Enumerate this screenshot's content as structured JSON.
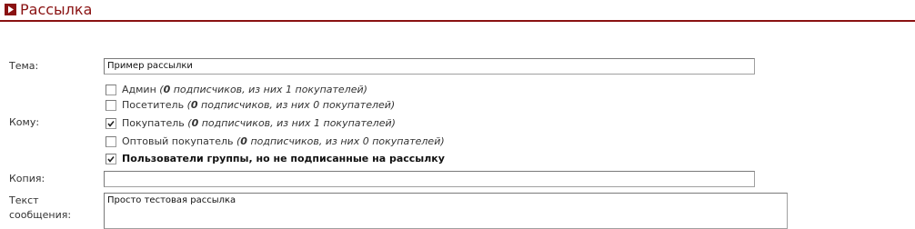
{
  "header": {
    "title": "Рассылка",
    "accent_color": "#8a1212",
    "icon": "play-arrow-icon"
  },
  "form": {
    "subject": {
      "label": "Тема:",
      "value": "Пример рассылки"
    },
    "recipients": {
      "label": "Кому:",
      "stats_open": "(",
      "stats_text_a": " подписчиков, из них ",
      "stats_text_b": " покупателей)",
      "items": [
        {
          "name": "Админ",
          "checked": false,
          "subscribers": "0",
          "buyers": "1"
        },
        {
          "name": "Посетитель",
          "checked": false,
          "subscribers": "0",
          "buyers": "0"
        },
        {
          "name": "Покупатель",
          "checked": true,
          "subscribers": "0",
          "buyers": "1"
        },
        {
          "name": "Оптовый покупатель",
          "checked": false,
          "subscribers": "0",
          "buyers": "0"
        }
      ],
      "group_option": {
        "label": "Пользователи группы, но не подписанные на рассылку",
        "checked": true
      }
    },
    "copy": {
      "label": "Копия:",
      "value": ""
    },
    "message": {
      "label_line1": "Текст",
      "label_line2": "сообщения:",
      "value": "Просто тестовая рассылка"
    }
  }
}
